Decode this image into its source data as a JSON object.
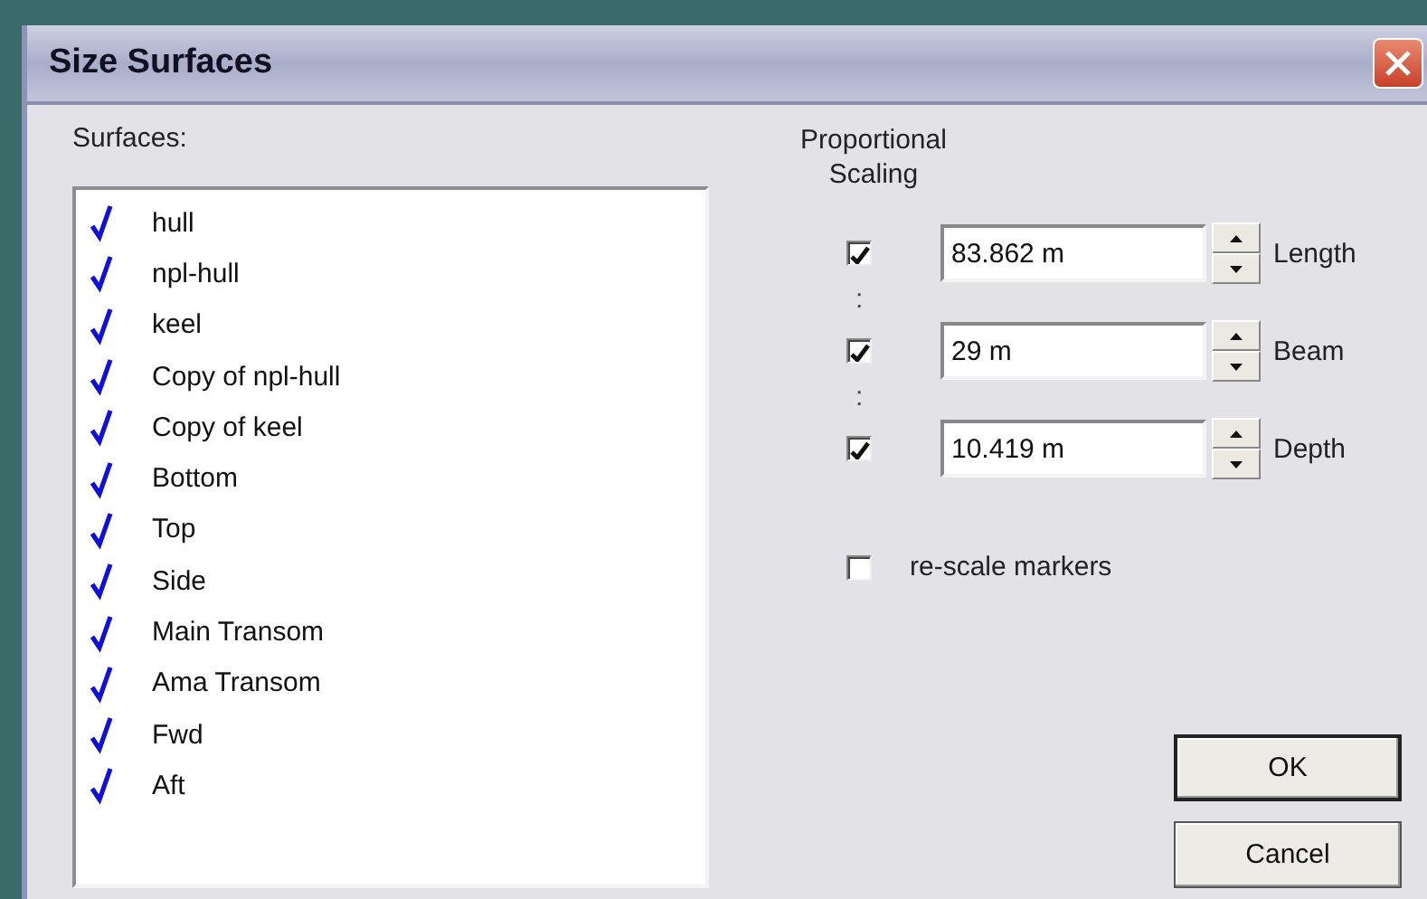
{
  "window": {
    "title": "Size Surfaces"
  },
  "surfaces": {
    "label": "Surfaces:",
    "items": [
      {
        "label": "hull",
        "checked": true
      },
      {
        "label": "npl-hull",
        "checked": true
      },
      {
        "label": "keel",
        "checked": true
      },
      {
        "label": "Copy of npl-hull",
        "checked": true
      },
      {
        "label": "Copy of keel",
        "checked": true
      },
      {
        "label": "Bottom",
        "checked": true
      },
      {
        "label": "Top",
        "checked": true
      },
      {
        "label": "Side",
        "checked": true
      },
      {
        "label": "Main Transom",
        "checked": true
      },
      {
        "label": "Ama Transom",
        "checked": true
      },
      {
        "label": "Fwd",
        "checked": true
      },
      {
        "label": "Aft",
        "checked": true
      }
    ]
  },
  "scaling": {
    "heading": [
      "Proportional",
      "Scaling"
    ],
    "rows": [
      {
        "checked": true,
        "value": "83.862 m",
        "label": "Length"
      },
      {
        "link": ":",
        "checked": true,
        "value": "29 m",
        "label": "Beam"
      },
      {
        "link": ":",
        "checked": true,
        "value": "10.419 m",
        "label": "Depth"
      }
    ]
  },
  "rescale_markers": {
    "label": "re-scale markers",
    "checked": false
  },
  "buttons": [
    "OK",
    "Cancel"
  ]
}
